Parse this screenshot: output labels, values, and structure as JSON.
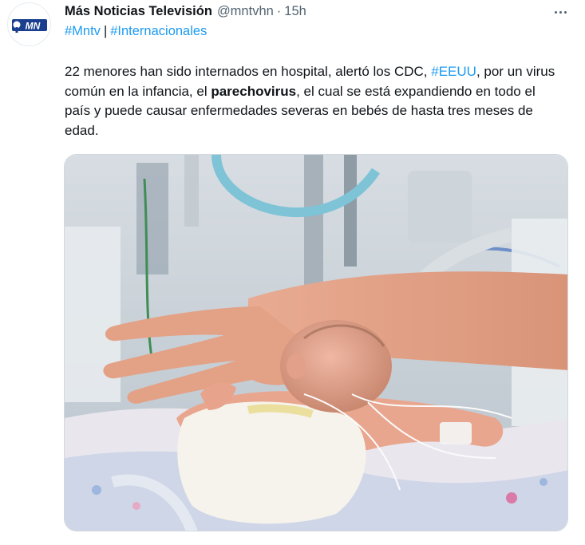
{
  "tweet": {
    "author_name": "Más Noticias Televisión",
    "author_handle": "@mntvhn",
    "separator": "·",
    "time": "15h",
    "avatar_text": "MN",
    "avatar_color": "#1a3f8f",
    "tags": [
      "#Mntv",
      "#Internacionales"
    ],
    "tag_separator": "|",
    "text_1": " 22 menores han sido internados en hospital, alertó los CDC, ",
    "hashtag_inline": "#EEUU",
    "text_2": ", por un virus común en la infancia, el ",
    "bold_word": "parechovirus",
    "text_3": ", el cual se está expandiendo en todo el país y puede causar enfermedades severas en bebés de hasta tres meses de edad.",
    "more_icon": "more-horizontal-icon",
    "link_color": "#1d9bf0"
  }
}
